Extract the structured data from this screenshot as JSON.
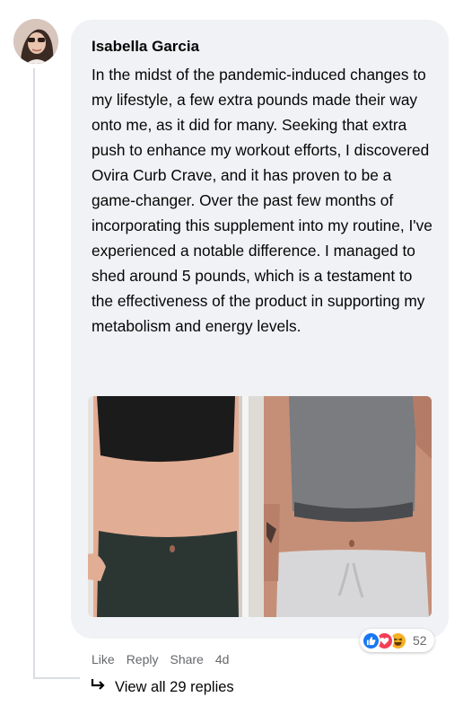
{
  "comment": {
    "author": "Isabella Garcia",
    "text": "In the midst of the pandemic-induced changes to my lifestyle, a few extra pounds made their way onto me, as it did for many. Seeking that extra push to enhance my workout efforts, I discovered Ovira Curb Crave, and it has proven to be a game-changer. Over the past few months of incorporating this supplement into my routine, I've experienced a notable difference. I managed to shed around 5 pounds, which is a testament to the effectiveness of the product in supporting my metabolism and energy levels.",
    "reaction_icons": [
      "like-icon",
      "love-icon",
      "haha-icon"
    ],
    "reaction_count": "52",
    "actions": {
      "like": "Like",
      "reply": "Reply",
      "share": "Share",
      "time": "4d"
    },
    "view_replies": "View all 29 replies"
  },
  "colors": {
    "bubble": "#f0f2f5",
    "like": "#1877f2",
    "love": "#f33e58",
    "haha": "#f7b125",
    "secondary_text": "#65676b"
  }
}
